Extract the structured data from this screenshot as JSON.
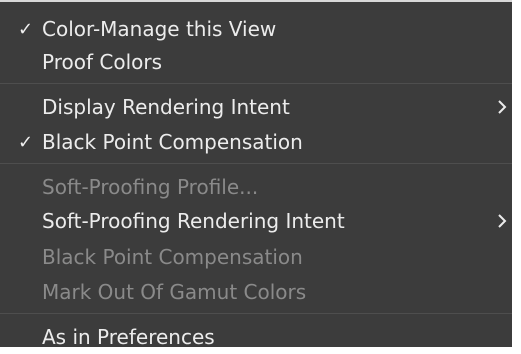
{
  "menu": {
    "items": [
      {
        "label": "Color-Manage this View",
        "checked": true,
        "enabled": true
      },
      {
        "label": "Proof Colors",
        "checked": false,
        "enabled": true
      },
      {
        "label": "Display Rendering Intent",
        "checked": false,
        "enabled": true,
        "submenu": true
      },
      {
        "label": "Black Point Compensation",
        "checked": true,
        "enabled": true
      },
      {
        "label": "Soft-Proofing Profile...",
        "checked": false,
        "enabled": false
      },
      {
        "label": "Soft-Proofing Rendering Intent",
        "checked": false,
        "enabled": true,
        "submenu": true
      },
      {
        "label": "Black Point Compensation",
        "checked": false,
        "enabled": false
      },
      {
        "label": "Mark Out Of Gamut Colors",
        "checked": false,
        "enabled": false
      },
      {
        "label": "As in Preferences",
        "checked": false,
        "enabled": true
      }
    ],
    "check_glyph": "✓"
  }
}
